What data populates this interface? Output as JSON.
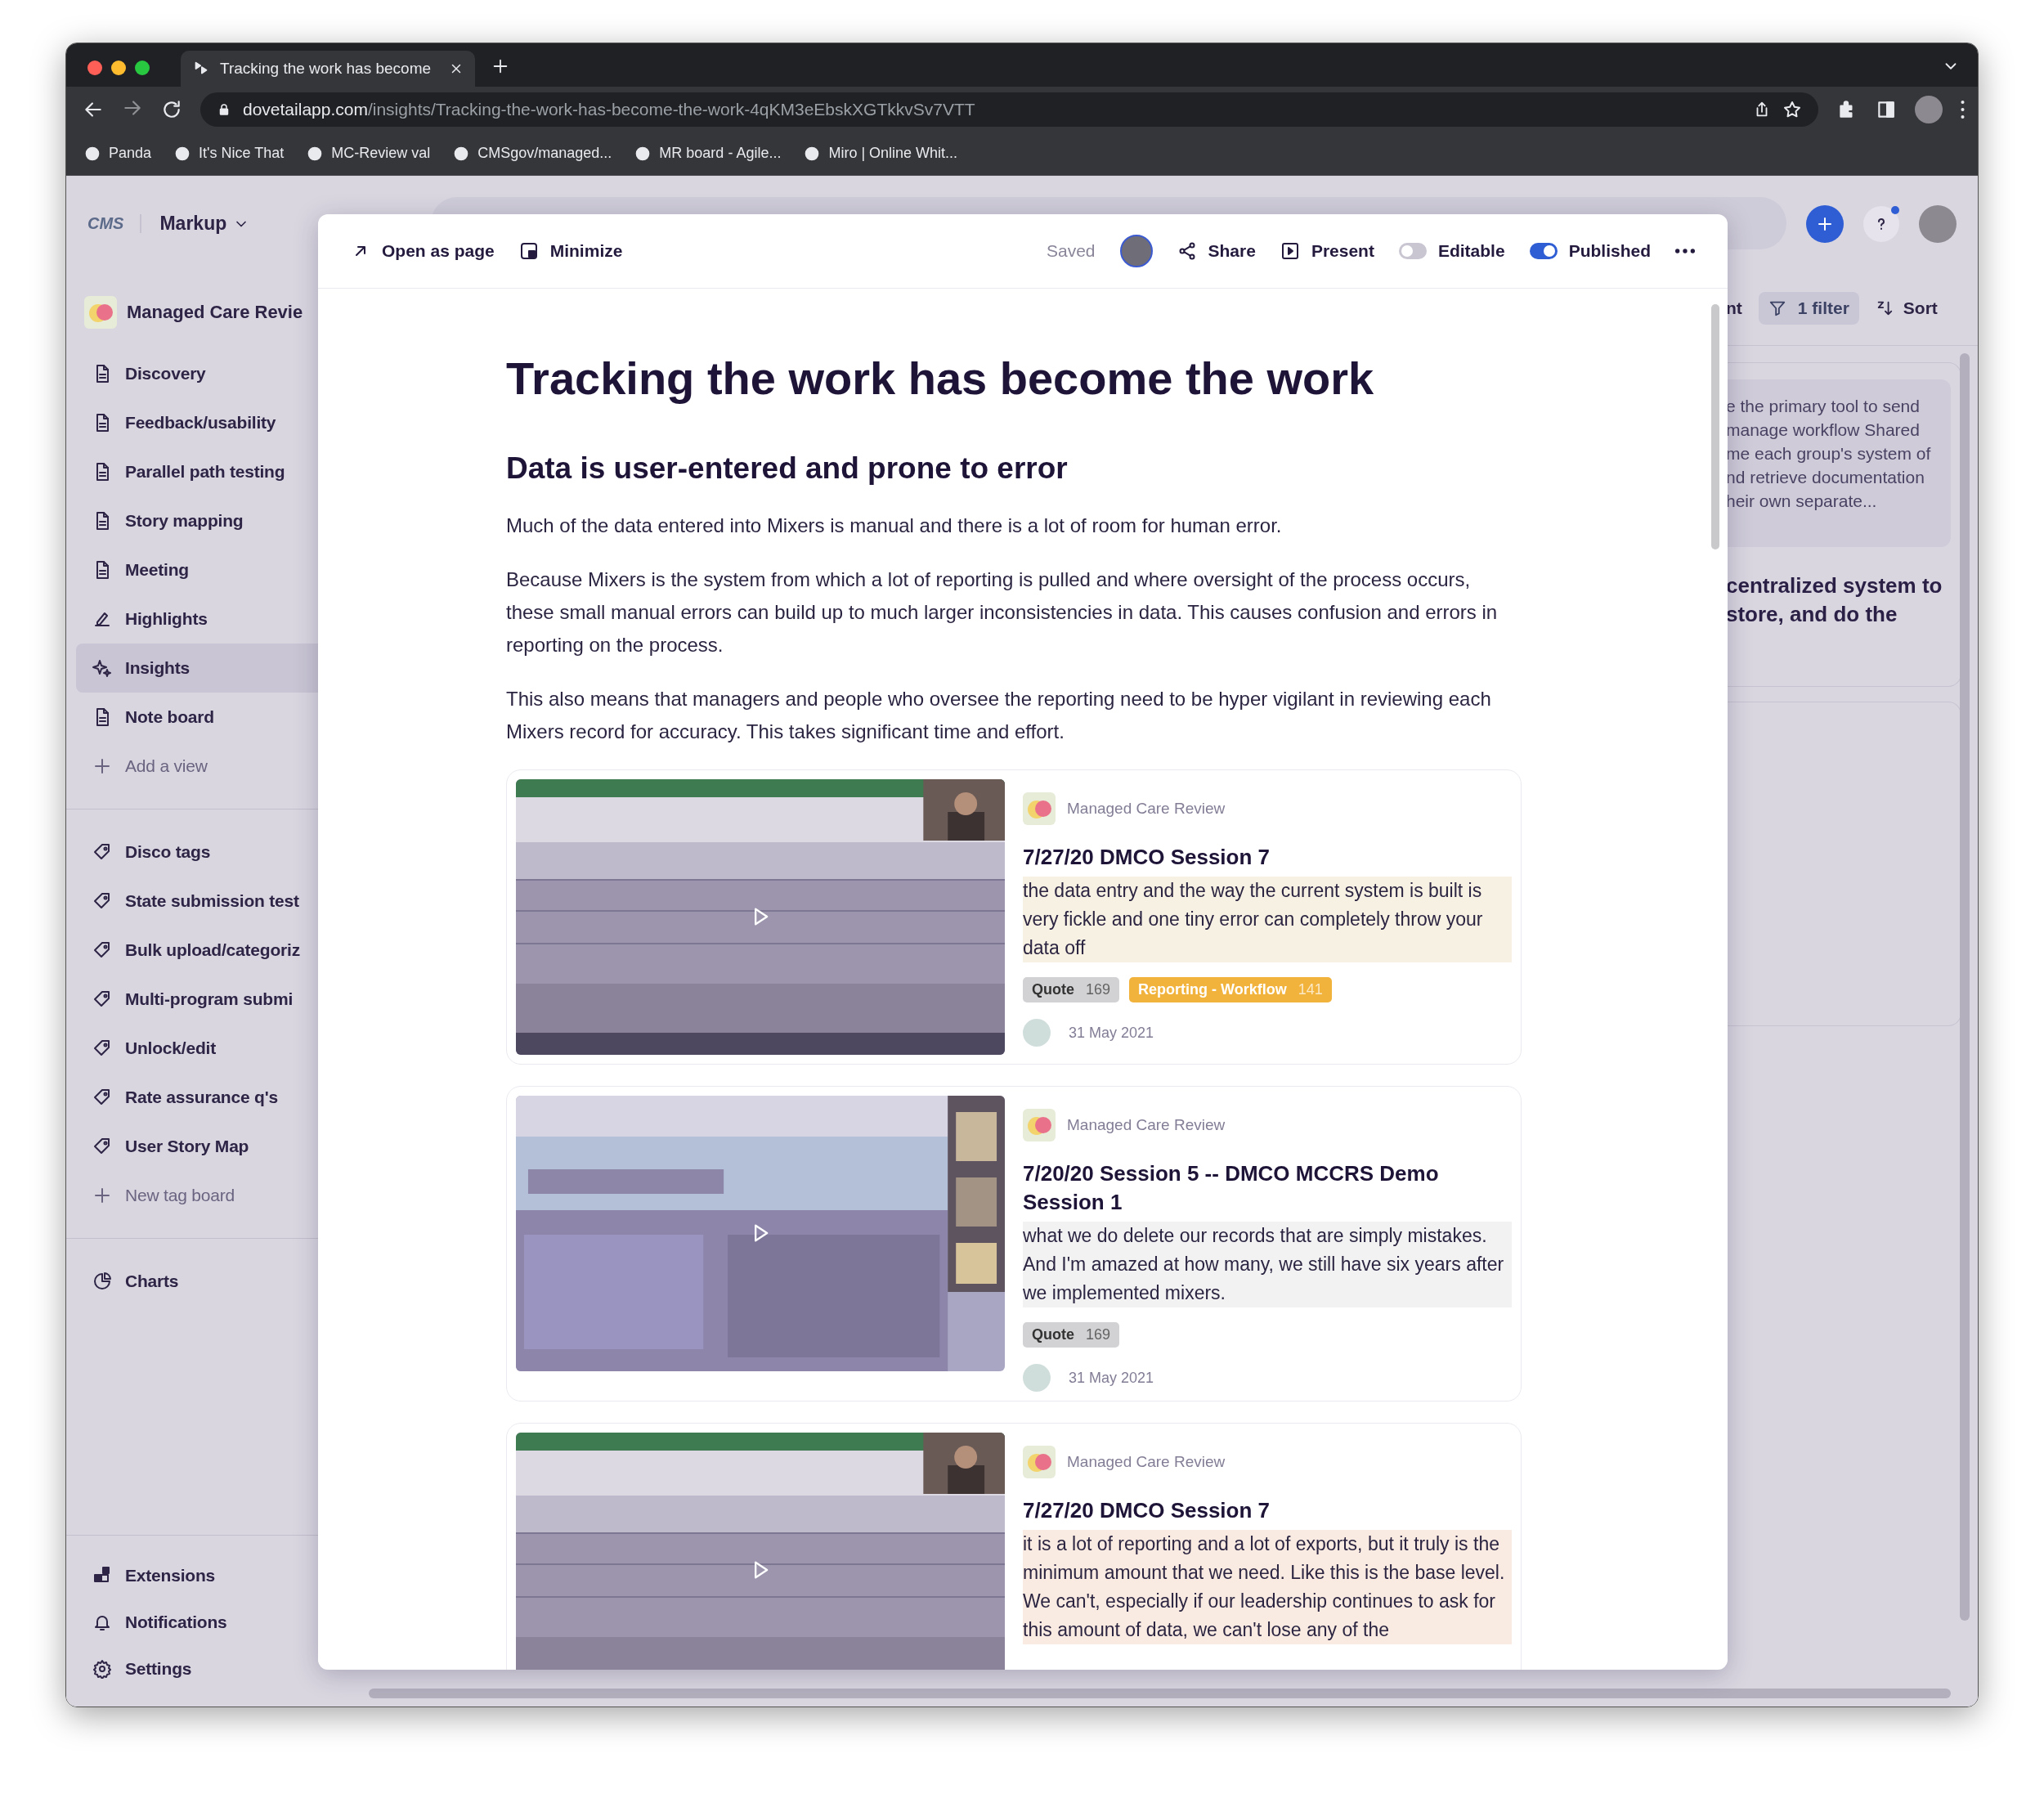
{
  "browser": {
    "tabs": [
      {
        "title": "Tracking the work has become",
        "selected": true
      }
    ],
    "url": {
      "domain": "dovetailapp.com",
      "path": "/insights/Tracking-the-work-has-become-the-work-4qKM3eEbskXGTkkvSv7VTT"
    },
    "bookmarks": [
      {
        "label": "Panda"
      },
      {
        "label": "It's Nice That"
      },
      {
        "label": "MC-Review val"
      },
      {
        "label": "CMSgov/managed..."
      },
      {
        "label": "MR board - Agile..."
      },
      {
        "label": "Miro | Online Whit..."
      }
    ]
  },
  "app": {
    "logo": "CMS",
    "workspace": "Markup"
  },
  "sidebar": {
    "project": "Managed Care Revie",
    "sections": [
      {
        "items": [
          {
            "label": "Discovery",
            "kind": "doc",
            "selected": false
          },
          {
            "label": "Feedback/usability",
            "kind": "doc",
            "selected": false
          },
          {
            "label": "Parallel path testing",
            "kind": "doc",
            "selected": false
          },
          {
            "label": "Story mapping",
            "kind": "doc",
            "selected": false
          },
          {
            "label": "Meeting",
            "kind": "doc",
            "selected": false
          },
          {
            "label": "Highlights",
            "kind": "highlights",
            "selected": false
          },
          {
            "label": "Insights",
            "kind": "insights",
            "selected": true
          },
          {
            "label": "Note board",
            "kind": "doc",
            "selected": false
          },
          {
            "label": "Add a view",
            "kind": "add",
            "selected": false
          }
        ]
      },
      {
        "items": [
          {
            "label": "Disco tags",
            "kind": "tag",
            "selected": false
          },
          {
            "label": "State submission test",
            "kind": "tag",
            "selected": false
          },
          {
            "label": "Bulk upload/categoriz",
            "kind": "tag",
            "selected": false
          },
          {
            "label": "Multi-program submi",
            "kind": "tag",
            "selected": false
          },
          {
            "label": "Unlock/edit",
            "kind": "tag",
            "selected": false
          },
          {
            "label": "Rate assurance q's",
            "kind": "tag",
            "selected": false
          },
          {
            "label": "User Story Map",
            "kind": "tag",
            "selected": false
          },
          {
            "label": "New tag board",
            "kind": "add",
            "selected": false
          }
        ]
      },
      {
        "items": [
          {
            "label": "Charts",
            "kind": "chart",
            "selected": false
          }
        ]
      }
    ],
    "footer": [
      {
        "label": "Extensions",
        "kind": "extensions",
        "selected": false
      },
      {
        "label": "Notifications",
        "kind": "bell",
        "selected": false
      },
      {
        "label": "Settings",
        "kind": "gear",
        "selected": false
      }
    ]
  },
  "background": {
    "column_label": "nt",
    "filter": "1 filter",
    "sort": "Sort",
    "card_lines": [
      "e the primary tool to send",
      "manage workflow Shared",
      "me each group's system of",
      "nd retrieve documentation",
      "heir own separate..."
    ],
    "heading_lines": [
      "centralized system to",
      "store, and do the"
    ]
  },
  "modal": {
    "actions": [
      {
        "label": "Open as page",
        "kind": "open"
      },
      {
        "label": "Minimize",
        "kind": "minimize"
      }
    ],
    "status": "Saved",
    "share": "Share",
    "present": "Present",
    "toggles": [
      {
        "label": "Editable",
        "on": false
      },
      {
        "label": "Published",
        "on": true
      }
    ]
  },
  "document": {
    "title": "Tracking the work has become the work",
    "heading": "Data is user-entered and prone to error",
    "paragraphs": [
      "Much of the data entered into Mixers is manual and there is a lot of room for human error.",
      "Because Mixers is the system from which a lot of reporting is pulled and where oversight of the process occurs, these small manual errors can build up to much larger inconsistencies in data. This causes confusion and errors in reporting on the process.",
      "This also means that managers and people who oversee the reporting need to be hyper vigilant in reviewing each Mixers record for accuracy. This takes significant time and effort."
    ],
    "highlights": [
      {
        "project": "Managed Care Review",
        "title": "7/27/20 DMCO Session 7",
        "quote": "the data entry and the way the current system is built is very fickle and one tiny error can completely throw your data off",
        "color": "#f7f1e3",
        "tags": [
          {
            "label": "Quote",
            "count": "169",
            "color": "#d2d2d4"
          },
          {
            "label": "Reporting - Workflow",
            "count": "141",
            "color": "#f2b33d"
          }
        ],
        "date": "31 May 2021"
      },
      {
        "project": "Managed Care Review",
        "title": "7/20/20 Session 5 -- DMCO MCCRS Demo Session 1",
        "quote": "what we do delete our records that are simply mistakes. And I'm amazed at how many, we still have six years after we implemented mixers.",
        "color": "#f2f2f3",
        "tags": [
          {
            "label": "Quote",
            "count": "169",
            "color": "#d2d2d4"
          }
        ],
        "date": "31 May 2021"
      },
      {
        "project": "Managed Care Review",
        "title": "7/27/20 DMCO Session 7",
        "quote": "it is a lot of reporting and a lot of exports, but it truly is the minimum amount that we need. Like this is the base level. We can't, especially if our leadership continues to ask for this amount of data, we can't lose any of the",
        "color": "#f9ebe1"
      }
    ]
  }
}
